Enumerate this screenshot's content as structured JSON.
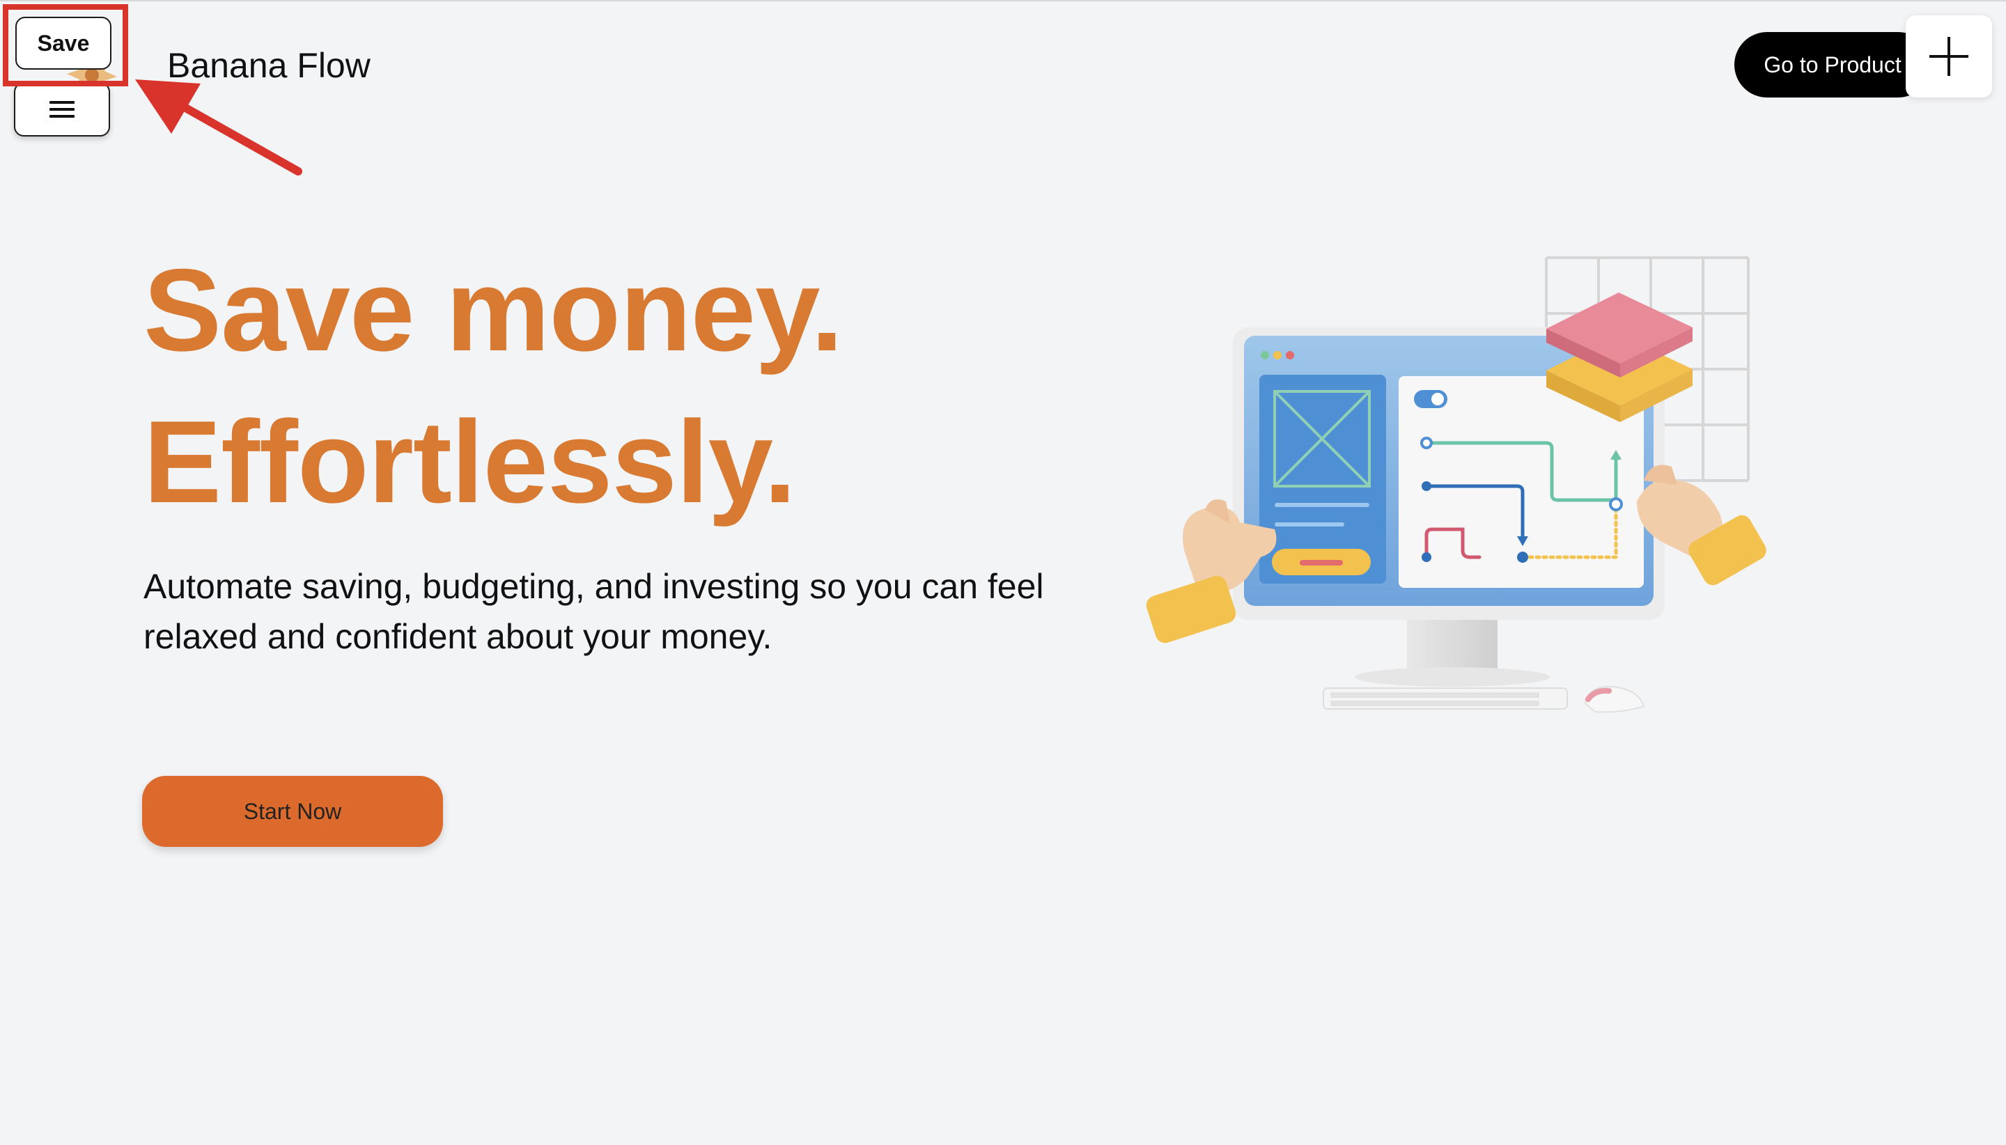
{
  "header": {
    "brand_name": "Banana Flow",
    "save_label": "Save",
    "menu_icon": "hamburger-menu-icon",
    "go_label": "Go to Product",
    "plus_icon": "plus-icon"
  },
  "hero": {
    "headline_line1": "Save money.",
    "headline_line2": "Effortlessly.",
    "subtext": "Automate saving, budgeting, and investing so you can feel relaxed and confident about your money.",
    "cta_label": "Start Now",
    "illustration_icon": "computer-workflow-illustration-icon"
  },
  "colors": {
    "background": "#f3f4f6",
    "headline": "#d97a33",
    "cta": "#dc6a2c",
    "annotation": "#d9342b",
    "dark_button": "#000000"
  }
}
